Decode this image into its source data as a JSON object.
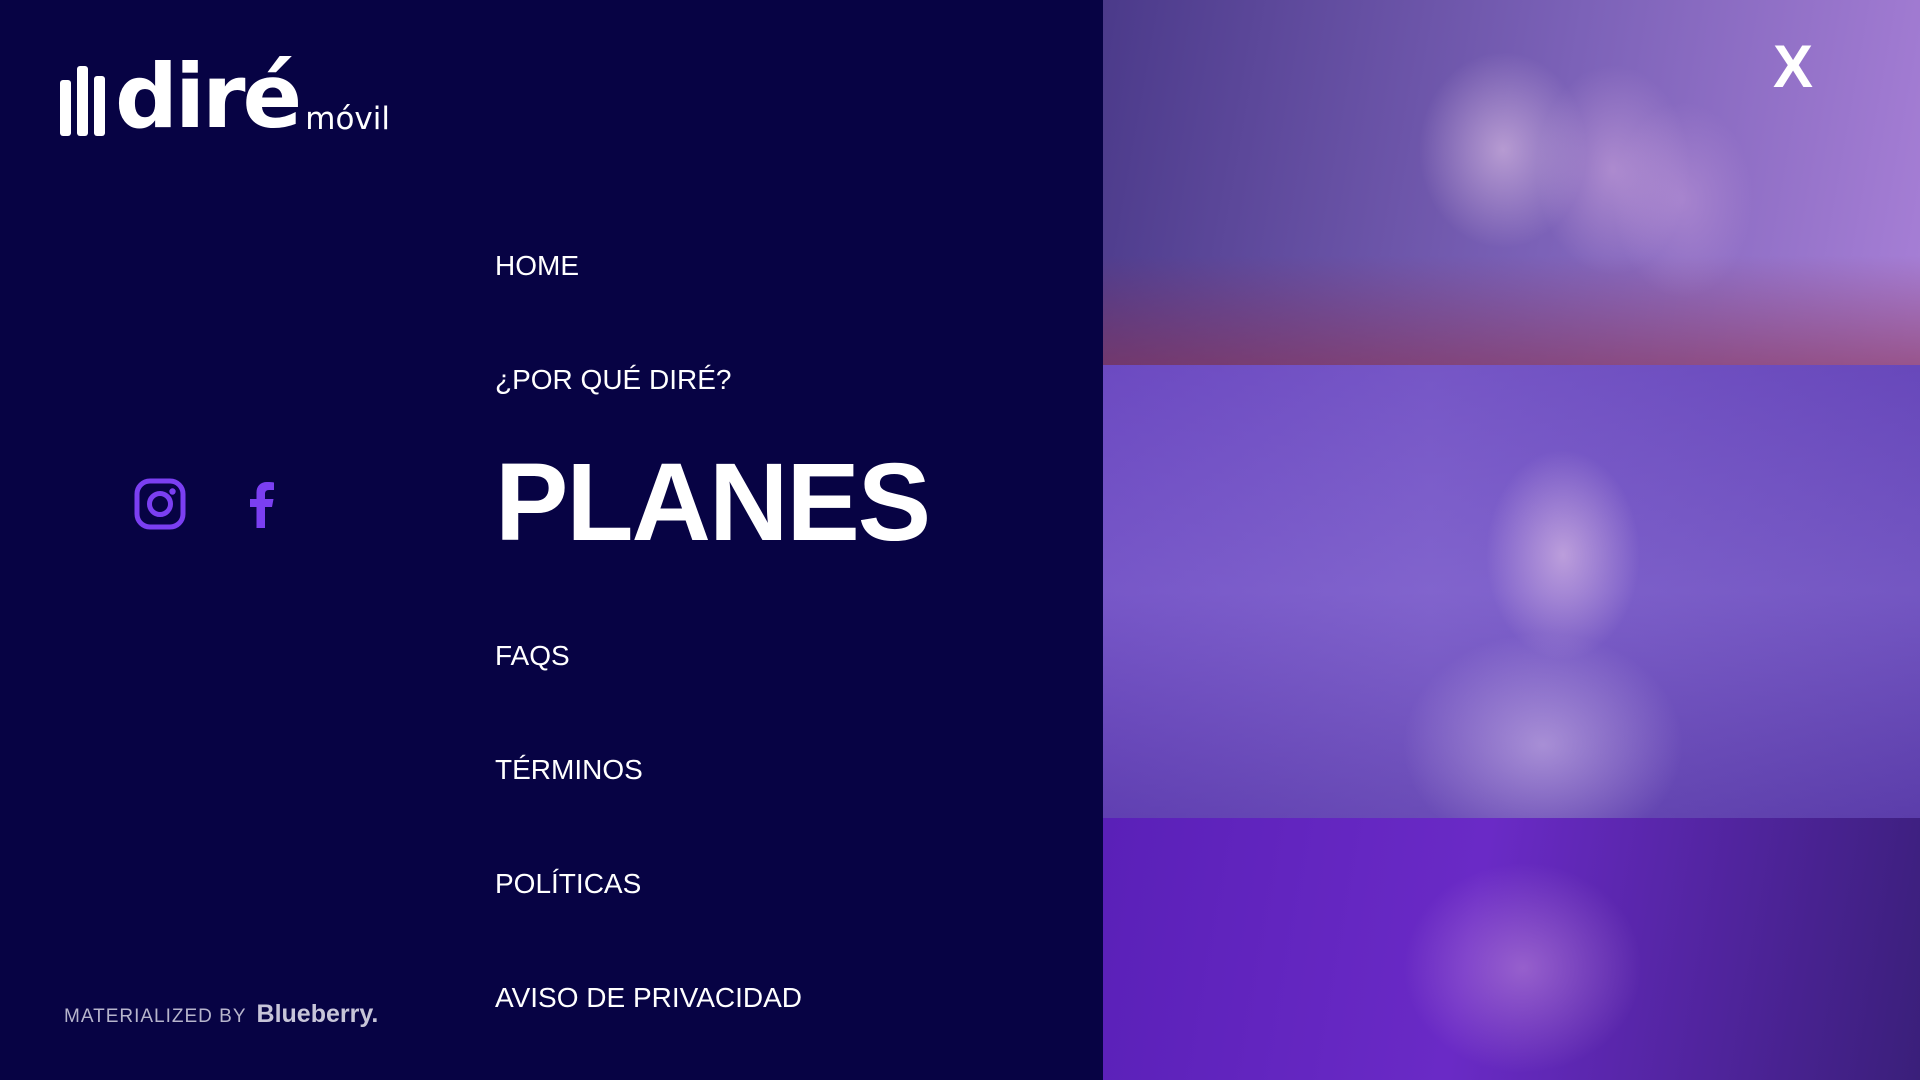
{
  "logo": {
    "word": "diré",
    "sub": "móvil"
  },
  "nav": {
    "items": [
      {
        "label": "HOME"
      },
      {
        "label": "¿POR QUÉ DIRÉ?"
      },
      {
        "label": "PLANES",
        "active": true
      },
      {
        "label": "FAQS"
      },
      {
        "label": "TÉRMINOS"
      },
      {
        "label": "POLÍTICAS"
      },
      {
        "label": "AVISO DE PRIVACIDAD"
      }
    ]
  },
  "social": [
    {
      "icon": "instagram-icon"
    },
    {
      "icon": "facebook-icon"
    }
  ],
  "credit": {
    "prefix": "MATERIALIZED BY",
    "brand": "Blueberry."
  },
  "close": {
    "label": "X"
  },
  "colors": {
    "background": "#070344",
    "accent": "#7b3ff2",
    "text": "#ffffff"
  }
}
